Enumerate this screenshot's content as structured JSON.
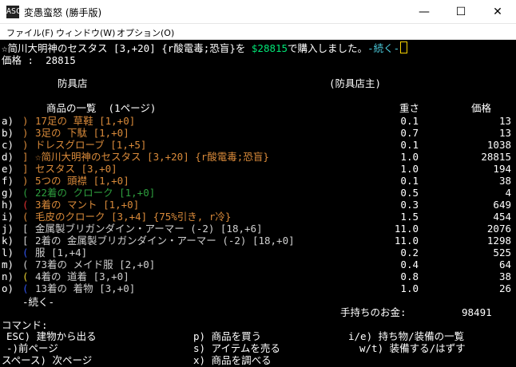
{
  "window": {
    "title": "変愚蛮怒 (勝手版)",
    "app_icon": "ASCII",
    "controls": [
      "—",
      "☐",
      "✕"
    ]
  },
  "menu": [
    "ファイル(F)",
    "ウィンドウ(W)",
    "オプション(O)"
  ],
  "message": {
    "prefix": "☆简川大明神のセスタス [3,+20] {r酸電毒;恐盲}を ",
    "price": "$28815",
    "suffix": "で購入しました。",
    "more": "-続く-"
  },
  "price_line": "価格 :  28815",
  "store": {
    "name": "防具店",
    "owner": "(防具店主)",
    "list_header": "商品の一覧  (1ページ)",
    "weight_header": "重さ",
    "price_header": "価格",
    "items": [
      {
        "key": "a)",
        "icon": ")",
        "icon_color": "#d98a3a",
        "name": "17足の 草鞋 [1,+0]",
        "name_color": "#d98a3a",
        "weight": "0.1",
        "price": "13"
      },
      {
        "key": "b)",
        "icon": ")",
        "icon_color": "#d98a3a",
        "name": "3足の 下駄 [1,+0]",
        "name_color": "#d98a3a",
        "weight": "0.7",
        "price": "13"
      },
      {
        "key": "c)",
        "icon": ")",
        "icon_color": "#d98a3a",
        "name": "ドレスグローブ [1,+5]",
        "name_color": "#d98a3a",
        "weight": "0.1",
        "price": "1038"
      },
      {
        "key": "d)",
        "icon": "]",
        "icon_color": "#d98a3a",
        "name": "☆简川大明神のセスタス [3,+20] {r酸電毒;恐盲}",
        "name_color": "#d98a3a",
        "weight": "1.0",
        "price": "28815"
      },
      {
        "key": "e)",
        "icon": "]",
        "icon_color": "#d98a3a",
        "name": "セスタス [3,+0]",
        "name_color": "#d98a3a",
        "weight": "1.0",
        "price": "194"
      },
      {
        "key": "f)",
        "icon": ")",
        "icon_color": "#d98a3a",
        "name": "5つの 頭襟 [1,+0]",
        "name_color": "#d98a3a",
        "weight": "0.1",
        "price": "38"
      },
      {
        "key": "g)",
        "icon": "(",
        "icon_color": "#2e9e3e",
        "name": "22着の クローク [1,+0]",
        "name_color": "#2e9e3e",
        "weight": "0.5",
        "price": "4"
      },
      {
        "key": "h)",
        "icon": "(",
        "icon_color": "#e03030",
        "name": "3着の マント [1,+0]",
        "name_color": "#d98a3a",
        "weight": "0.3",
        "price": "649"
      },
      {
        "key": "i)",
        "icon": "(",
        "icon_color": "#d98a3a",
        "name": "毛皮のクローク [3,+4] {75%引き, r冷}",
        "name_color": "#d98a3a",
        "weight": "1.5",
        "price": "454"
      },
      {
        "key": "j)",
        "icon": "[",
        "icon_color": "#d0d0d0",
        "name": "金属製ブリガンダイン・アーマー (-2) [18,+6]",
        "name_color": "#d0d0d0",
        "weight": "11.0",
        "price": "2076"
      },
      {
        "key": "k)",
        "icon": "[",
        "icon_color": "#d0d0d0",
        "name": "2着の 金属製ブリガンダイン・アーマー (-2) [18,+0]",
        "name_color": "#d0d0d0",
        "weight": "11.0",
        "price": "1298"
      },
      {
        "key": "l)",
        "icon": "(",
        "icon_color": "#3355ee",
        "name": "服 [1,+4]",
        "name_color": "#d0d0d0",
        "weight": "0.2",
        "price": "525"
      },
      {
        "key": "m)",
        "icon": "(",
        "icon_color": "#d0d0d0",
        "name": "73着の メイド服 [2,+0]",
        "name_color": "#d0d0d0",
        "weight": "0.4",
        "price": "64"
      },
      {
        "key": "n)",
        "icon": "(",
        "icon_color": "#e8d030",
        "name": "4着の 道着 [3,+0]",
        "name_color": "#d0d0d0",
        "weight": "0.8",
        "price": "38"
      },
      {
        "key": "o)",
        "icon": "(",
        "icon_color": "#3355ee",
        "name": "13着の 着物 [3,+0]",
        "name_color": "#d0d0d0",
        "weight": "1.0",
        "price": "26"
      }
    ],
    "more": "-続く-",
    "gold_label": "手持ちのお金:",
    "gold": "98491"
  },
  "commands": {
    "header": "コマンド:",
    "c1": "ESC) 建物から出る",
    "c2": "-)前ページ",
    "c3": "スペース) 次ページ",
    "c4": "p) 商品を買う",
    "c5": "s) アイテムを売る",
    "c6": "x) 商品を調べる",
    "c7": "i/e) 持ち物/装備の一覧",
    "c8": "w/t) 装備する/はずす"
  }
}
